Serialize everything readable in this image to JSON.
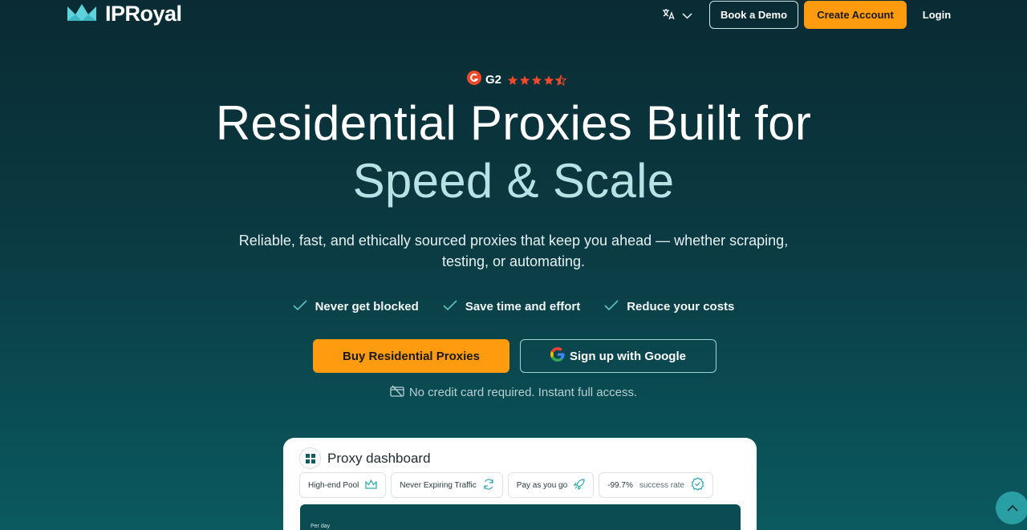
{
  "nav": {
    "logo_text": "IPRoyal",
    "language_icon": "translate-icon",
    "book_demo": "Book a Demo",
    "create_account": "Create Account",
    "login": "Login"
  },
  "rating": {
    "label": "G2",
    "stars": 4.5
  },
  "hero": {
    "title_part1": "Residential Proxies Built for",
    "title_part2": "Speed & Scale",
    "subtitle": "Reliable, fast, and ethically sourced proxies that keep you ahead — whether scraping, testing, or automating."
  },
  "features": [
    "Never get blocked",
    "Save time and effort",
    "Reduce your costs"
  ],
  "cta": {
    "buy": "Buy Residential Proxies",
    "google": "Sign up with Google",
    "note": "No credit card required. Instant full access."
  },
  "dashboard": {
    "title": "Proxy dashboard",
    "chips": {
      "pool": "High-end Pool",
      "traffic": "Never Expiring Traffic",
      "payg": "Pay as you go",
      "rate_value": "-99.7%",
      "rate_label": "success rate"
    },
    "chart_label": "Per day"
  },
  "colors": {
    "accent_orange": "#ff9b0f",
    "title_light": "#b7e3e6",
    "background_dark": "#0a2b33"
  }
}
